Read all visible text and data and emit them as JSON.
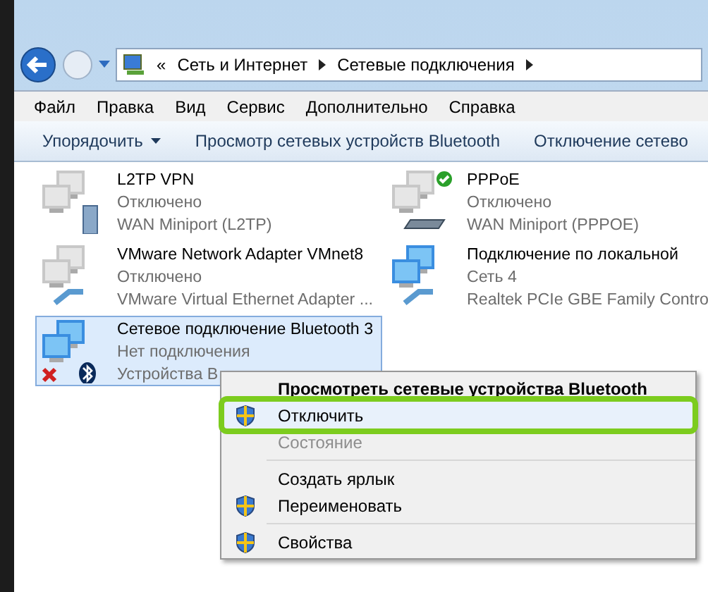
{
  "address_bar": {
    "overflow": "«",
    "crumbs": [
      "Сеть и Интернет",
      "Сетевые подключения"
    ]
  },
  "menu_bar": [
    "Файл",
    "Правка",
    "Вид",
    "Сервис",
    "Дополнительно",
    "Справка"
  ],
  "toolbar": [
    {
      "label": "Упорядочить",
      "dropdown": true
    },
    {
      "label": "Просмотр сетевых устройств Bluetooth",
      "dropdown": false
    },
    {
      "label": "Отключение сетево",
      "dropdown": false
    }
  ],
  "connections": [
    {
      "name": "L2TP VPN",
      "status": "Отключено",
      "adapter": "WAN Miniport (L2TP)",
      "kind": "server",
      "connected": false,
      "ok": false,
      "error": false,
      "selected": false
    },
    {
      "name": "PPPoE",
      "status": "Отключено",
      "adapter": "WAN Miniport (PPPOE)",
      "kind": "modem",
      "connected": false,
      "ok": true,
      "error": false,
      "selected": false
    },
    {
      "name": "VMware Network Adapter VMnet8",
      "status": "Отключено",
      "adapter": "VMware Virtual Ethernet Adapter ...",
      "kind": "cable",
      "connected": false,
      "ok": false,
      "error": false,
      "selected": false
    },
    {
      "name": "Подключение по локальной",
      "status": "Сеть  4",
      "adapter": "Realtek PCIe GBE Family Contro",
      "kind": "cable",
      "connected": true,
      "ok": false,
      "error": false,
      "selected": false
    },
    {
      "name": "Сетевое подключение Bluetooth 3",
      "status": "Нет подключения",
      "adapter": "Устройства B",
      "kind": "bluetooth",
      "connected": true,
      "ok": false,
      "error": true,
      "selected": true
    }
  ],
  "context_menu": [
    {
      "label": "Просмотреть сетевые устройства Bluetooth",
      "kind": "default",
      "shield": false,
      "disabled": false,
      "selected": false
    },
    {
      "label": "Отключить",
      "kind": "item",
      "shield": true,
      "disabled": false,
      "selected": true
    },
    {
      "label": "Состояние",
      "kind": "item",
      "shield": false,
      "disabled": true,
      "selected": false
    },
    {
      "kind": "separator"
    },
    {
      "label": "Создать ярлык",
      "kind": "item",
      "shield": false,
      "disabled": false,
      "selected": false
    },
    {
      "label": "Переименовать",
      "kind": "item",
      "shield": true,
      "disabled": false,
      "selected": false
    },
    {
      "kind": "separator"
    },
    {
      "label": "Свойства",
      "kind": "item",
      "shield": true,
      "disabled": false,
      "selected": false
    }
  ]
}
